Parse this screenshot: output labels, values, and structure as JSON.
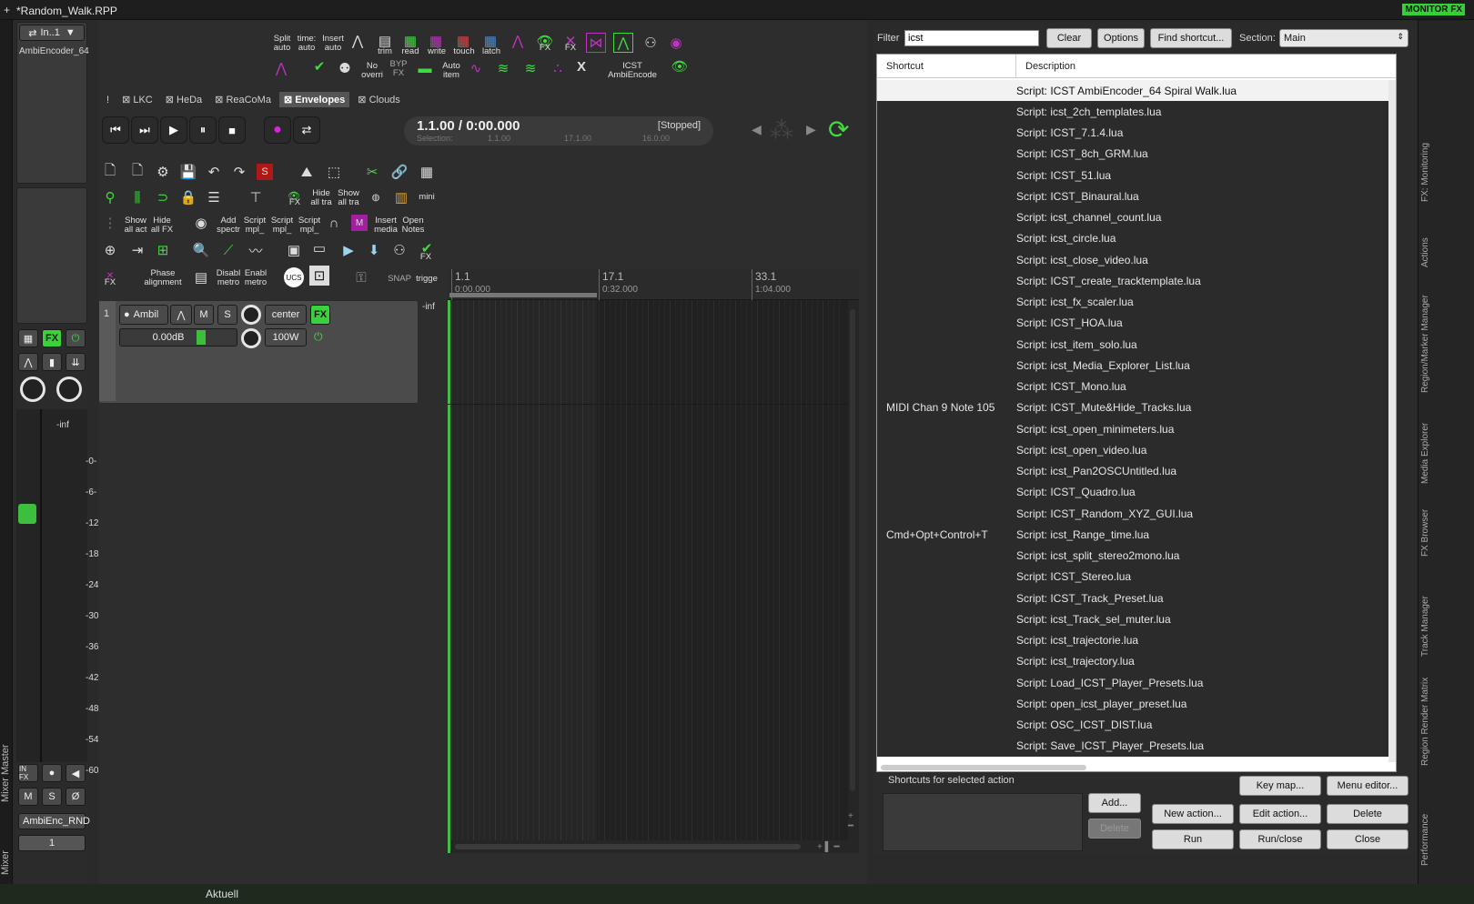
{
  "window": {
    "title": "*Random_Walk.RPP",
    "monitor_fx": "MONITOR FX"
  },
  "left_strip": {
    "label_mixer_master": "Mixer Master",
    "label_mixer": "Mixer"
  },
  "mixer": {
    "input_label": "In..1",
    "fx_name": "AmbiEncoder_64",
    "fx_button": "FX",
    "meter_top": "-inf",
    "scale": [
      "-0-",
      "-6-",
      "-12-",
      "-18-",
      "-24-",
      "-30-",
      "-36-",
      "-42-",
      "-48-",
      "-54-",
      "-60-"
    ],
    "in_fx": "IN FX",
    "mute": "M",
    "solo": "S",
    "phase": "Ø",
    "track_name": "AmbiEnc_RND",
    "track_number": "1"
  },
  "top_toolbar": {
    "split": "Split",
    "auto1": "auto",
    "time": "time:",
    "auto2": "auto",
    "insert": "Insert",
    "auto3": "auto",
    "trim": "trim",
    "read": "read",
    "write": "write",
    "touch": "touch",
    "latch": "latch",
    "fx": "FX",
    "fx2": "FX",
    "no_overri": "No overri",
    "byp": "BYP",
    "byp_fx": "FX",
    "auto_item": "Auto item",
    "icst": "ICST AmbiEncode",
    "fx_check": "FX"
  },
  "tabs": [
    {
      "label": "LKC",
      "active": false
    },
    {
      "label": "HeDa",
      "active": false
    },
    {
      "label": "ReaCoMa",
      "active": false
    },
    {
      "label": "Envelopes",
      "active": true
    },
    {
      "label": "Clouds",
      "active": false
    }
  ],
  "transport": {
    "position": "1.1.00 / 0:00.000",
    "state": "[Stopped]",
    "selection_label": "Selection:",
    "sel_start": "1.1.00",
    "sel_end": "17.1.00",
    "sel_len": "16.0.00"
  },
  "toolbar2": {
    "show_all": "Show all act",
    "hide_all": "Hide all FX",
    "add_spectr": "Add spectr",
    "script1": "Script mpl_",
    "script2": "Script mpl_",
    "script3": "Script mpl_",
    "insert_media": "Insert media",
    "open_notes": "Open Notes",
    "hide_all_tra": "Hide all tra",
    "show_all_tra": "Show all tra",
    "mini": "mini",
    "phase_alignment": "Phase alignment",
    "disabl_metro": "Disabl metro",
    "enabl_metro": "Enabl metro",
    "snap": "SNAP",
    "trigge": "trigge",
    "fx3": "FX",
    "fx4": "FX",
    "ucs": "UCS",
    "s_red": "S",
    "m_badge": "M"
  },
  "ruler": {
    "marks": [
      {
        "bar": "1.1",
        "time": "0:00.000"
      },
      {
        "bar": "17.1",
        "time": "0:32.000"
      },
      {
        "bar": "33.1",
        "time": "1:04.000"
      }
    ]
  },
  "track": {
    "number": "1",
    "name": "Ambil",
    "mute": "M",
    "solo": "S",
    "pan": "center",
    "fx": "FX",
    "volume": "0.00dB",
    "width": "100W",
    "meter": "-inf"
  },
  "actions": {
    "filter_label": "Filter",
    "filter_value": "icst",
    "clear": "Clear",
    "options": "Options",
    "find_shortcut": "Find shortcut...",
    "section_label": "Section:",
    "section_value": "Main",
    "col_shortcut": "Shortcut",
    "col_description": "Description",
    "rows": [
      {
        "shortcut": "",
        "description": "Script: ICST AmbiEncoder_64 Spiral Walk.lua",
        "selected": true
      },
      {
        "shortcut": "",
        "description": "Script: icst_2ch_templates.lua"
      },
      {
        "shortcut": "",
        "description": "Script: ICST_7.1.4.lua"
      },
      {
        "shortcut": "",
        "description": "Script: ICST_8ch_GRM.lua"
      },
      {
        "shortcut": "",
        "description": "Script: ICST_51.lua"
      },
      {
        "shortcut": "",
        "description": "Script: ICST_Binaural.lua"
      },
      {
        "shortcut": "",
        "description": "Script: icst_channel_count.lua"
      },
      {
        "shortcut": "",
        "description": "Script: icst_circle.lua"
      },
      {
        "shortcut": "",
        "description": "Script: icst_close_video.lua"
      },
      {
        "shortcut": "",
        "description": "Script: ICST_create_tracktemplate.lua"
      },
      {
        "shortcut": "",
        "description": "Script: icst_fx_scaler.lua"
      },
      {
        "shortcut": "",
        "description": "Script: ICST_HOA.lua"
      },
      {
        "shortcut": "",
        "description": "Script: icst_item_solo.lua"
      },
      {
        "shortcut": "",
        "description": "Script: icst_Media_Explorer_List.lua"
      },
      {
        "shortcut": "",
        "description": "Script: ICST_Mono.lua"
      },
      {
        "shortcut": "MIDI Chan 9 Note 105",
        "description": "Script: ICST_Mute&Hide_Tracks.lua"
      },
      {
        "shortcut": "",
        "description": "Script: icst_open_minimeters.lua"
      },
      {
        "shortcut": "",
        "description": "Script: icst_open_video.lua"
      },
      {
        "shortcut": "",
        "description": "Script: icst_Pan2OSCUntitled.lua"
      },
      {
        "shortcut": "",
        "description": "Script: ICST_Quadro.lua"
      },
      {
        "shortcut": "",
        "description": "Script: ICST_Random_XYZ_GUI.lua"
      },
      {
        "shortcut": "Cmd+Opt+Control+T",
        "description": "Script: icst_Range_time.lua"
      },
      {
        "shortcut": "",
        "description": "Script: icst_split_stereo2mono.lua"
      },
      {
        "shortcut": "",
        "description": "Script: ICST_Stereo.lua"
      },
      {
        "shortcut": "",
        "description": "Script: ICST_Track_Preset.lua"
      },
      {
        "shortcut": "",
        "description": "Script: icst_Track_sel_muter.lua"
      },
      {
        "shortcut": "",
        "description": "Script: icst_trajectorie.lua"
      },
      {
        "shortcut": "",
        "description": "Script: icst_trajectory.lua"
      },
      {
        "shortcut": "",
        "description": "Script: Load_ICST_Player_Presets.lua"
      },
      {
        "shortcut": "",
        "description": "Script: open_icst_player_preset.lua"
      },
      {
        "shortcut": "",
        "description": "Script: OSC_ICST_DIST.lua"
      },
      {
        "shortcut": "",
        "description": "Script: Save_ICST_Player_Presets.lua"
      }
    ],
    "shortcuts_for_selected": "Shortcuts for selected action",
    "add": "Add...",
    "delete_shortcut": "Delete",
    "key_map": "Key map...",
    "menu_editor": "Menu editor...",
    "new_action": "New action...",
    "edit_action": "Edit action...",
    "delete": "Delete",
    "run": "Run",
    "run_close": "Run/close",
    "close": "Close"
  },
  "right_dock": [
    "FX: Monitoring",
    "Actions",
    "Region/Marker Manager",
    "Media Explorer",
    "FX Browser",
    "Track Manager",
    "Region Render Matrix",
    "Performance"
  ],
  "status": {
    "aktuell": "Aktuell"
  }
}
